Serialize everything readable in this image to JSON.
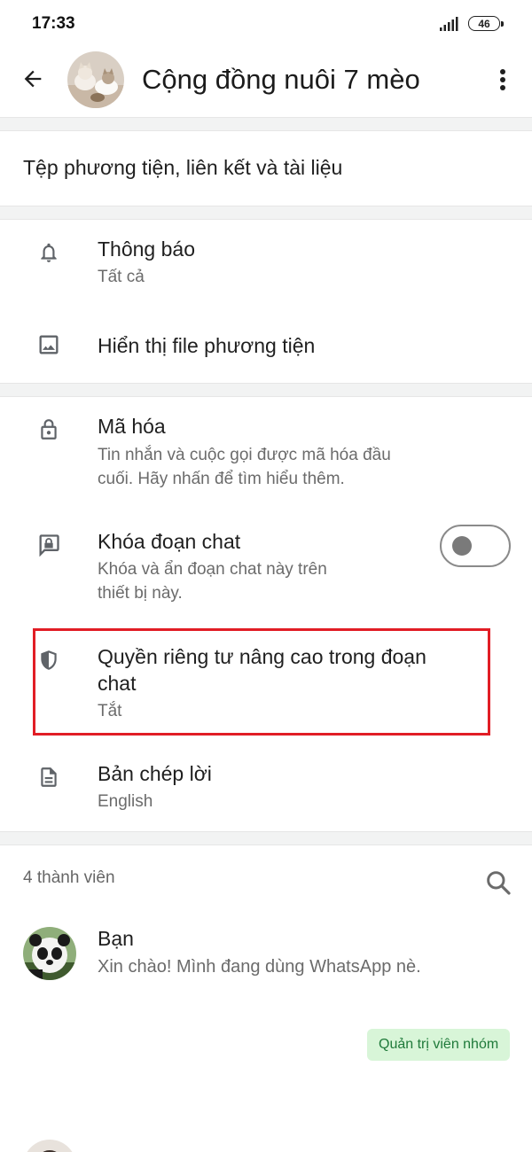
{
  "status_bar": {
    "time": "17:33",
    "battery": "46",
    "signal_icon": "signal-bars-icon"
  },
  "header": {
    "title": "Cộng đồng nuôi 7 mèo",
    "back_icon": "arrow-left-icon",
    "more_icon": "more-vertical-icon"
  },
  "media": {
    "label": "Tệp phương tiện, liên kết và tài liệu"
  },
  "settings": {
    "notifications": {
      "title": "Thông báo",
      "subtitle": "Tất cả",
      "icon": "bell-icon"
    },
    "media_visibility": {
      "title": "Hiển thị file phương tiện",
      "icon": "image-icon"
    },
    "encryption": {
      "title": "Mã hóa",
      "line1": "Tin nhắn và cuộc gọi được mã hóa đầu",
      "line2": "cuối. Hãy nhấn để tìm hiểu thêm.",
      "icon": "lock-icon"
    },
    "chat_lock": {
      "title": "Khóa đoạn chat",
      "line1": "Khóa và ẩn đoạn chat này trên",
      "line2": "thiết bị này.",
      "icon": "chat-lock-icon",
      "enabled": false
    },
    "advanced_privacy": {
      "line1": "Quyền riêng tư nâng cao trong đoạn",
      "line2": "chat",
      "subtitle": "Tắt",
      "icon": "shield-icon",
      "highlight_color": "#e11d25"
    },
    "transcript": {
      "title": "Bản chép lời",
      "subtitle": "English",
      "icon": "document-icon"
    }
  },
  "members": {
    "count_label": "4 thành viên",
    "search_icon": "search-icon",
    "list": [
      {
        "name": "Bạn",
        "status": "Xin chào! Mình đang dùng WhatsApp nè.",
        "badge": "Quản trị viên nhóm"
      }
    ]
  },
  "colors": {
    "badge_bg": "#d8f5d8",
    "badge_text": "#1f7a3a",
    "highlight": "#e11d25"
  }
}
